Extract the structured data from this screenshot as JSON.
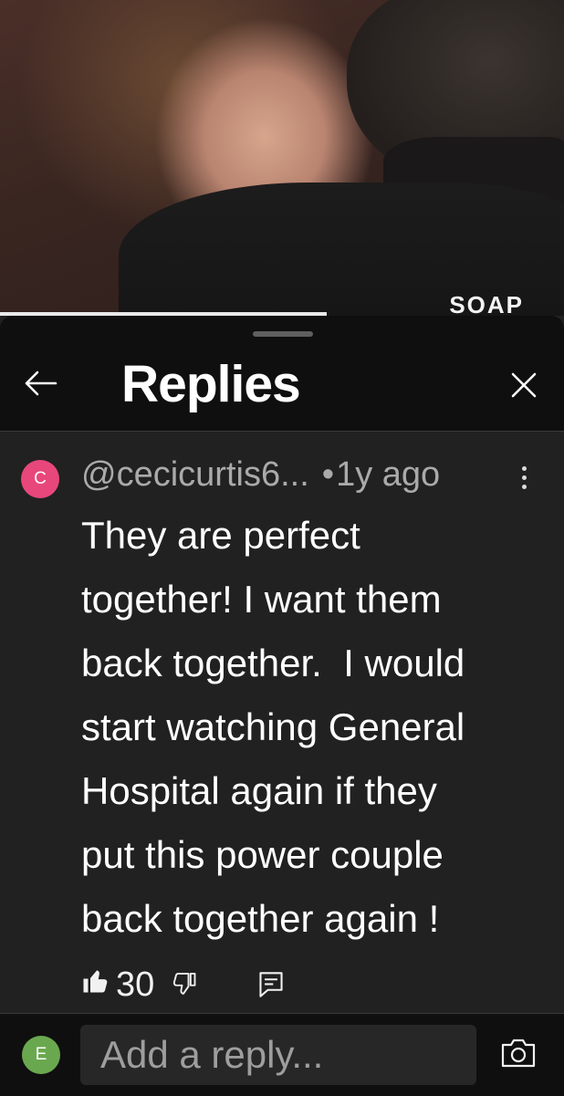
{
  "video": {
    "watermark_text": "SOAP",
    "progress_fraction": 0.58
  },
  "header": {
    "title": "Replies",
    "back_icon": "arrow-left-icon",
    "close_icon": "close-icon"
  },
  "comment": {
    "avatar_letter": "C",
    "avatar_color": "#e8477c",
    "author": "@cecicurtis6...",
    "separator": "•",
    "time": "1y ago",
    "text": "They are perfect\ntogether! I want them\nback together.  I would\nstart watching General\nHospital again if they\nput this power couple\nback together again !",
    "like_count": "30",
    "icons": [
      "like-icon",
      "dislike-icon",
      "reply-icon",
      "more-vertical-icon"
    ]
  },
  "footer": {
    "avatar_letter": "E",
    "avatar_color": "#6aa84f",
    "reply_placeholder": "Add a reply...",
    "camera_icon": "camera-icon"
  },
  "colors": {
    "background": "#212121",
    "header_background": "#0f0f0f",
    "secondary_text": "#aaaaaa"
  }
}
